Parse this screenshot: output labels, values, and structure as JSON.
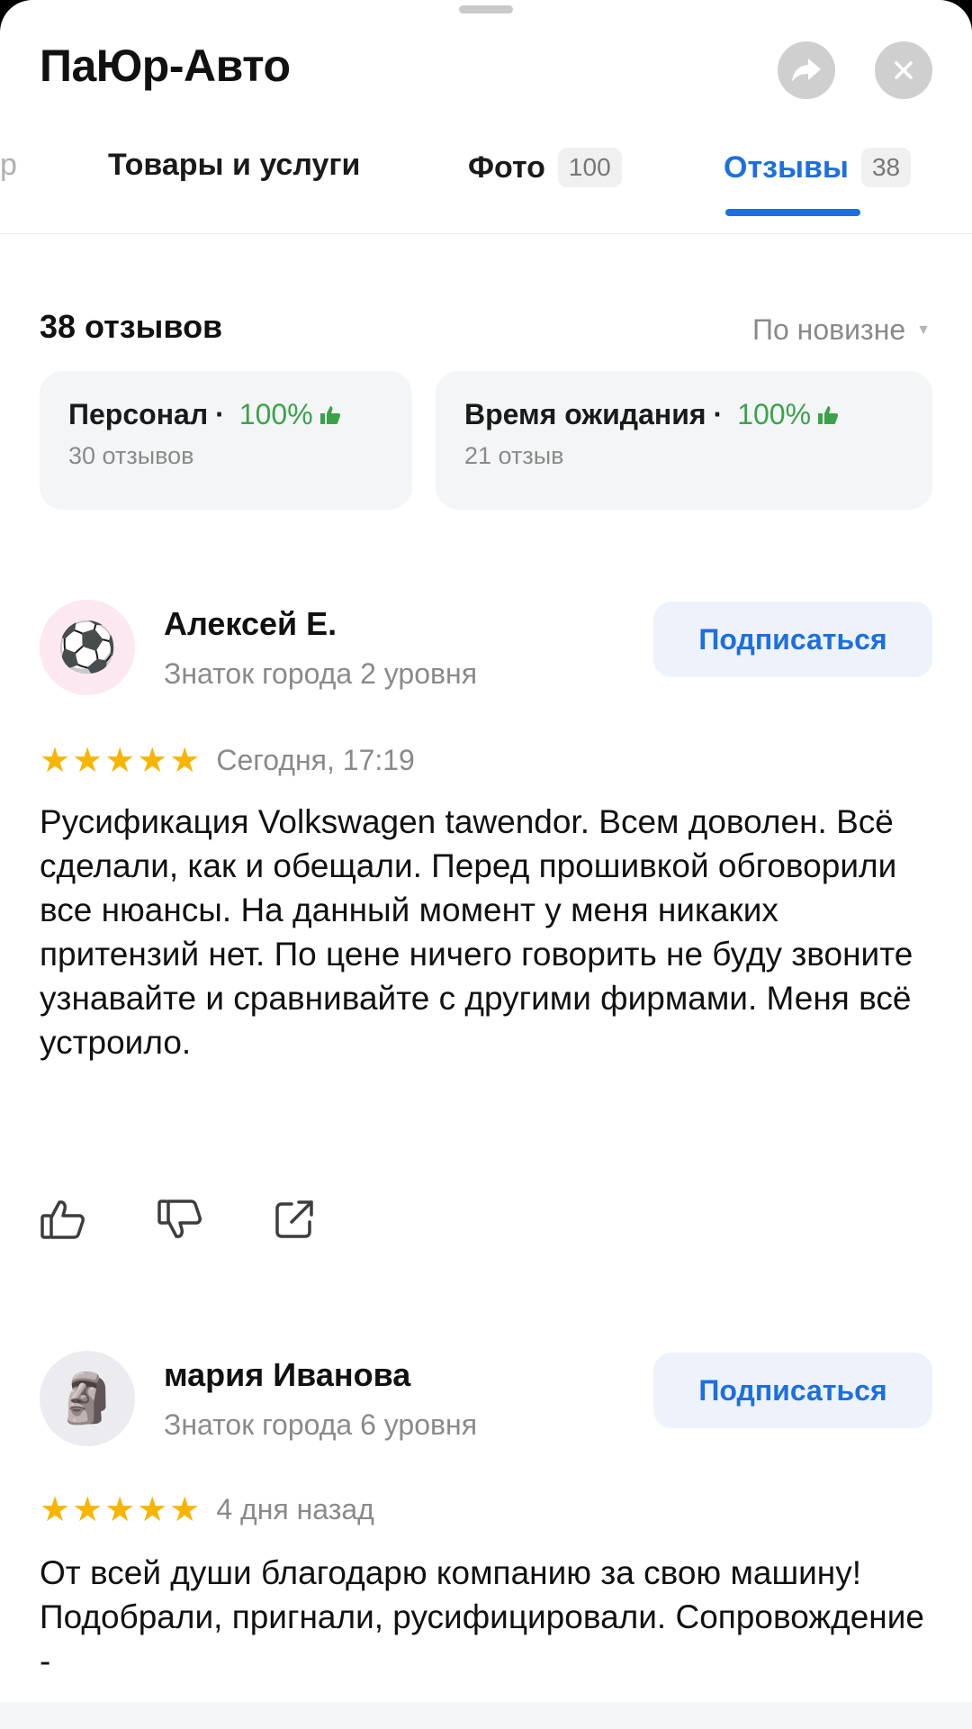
{
  "header": {
    "title": "ПаЮр-Авто",
    "share_icon": "share-arrow-icon",
    "close_icon": "close-icon"
  },
  "tabs": [
    {
      "label": "р",
      "cut": true
    },
    {
      "label": "Товары и услуги"
    },
    {
      "label": "Фото",
      "count": "100"
    },
    {
      "label": "Отзывы",
      "count": "38",
      "active": true
    }
  ],
  "summary": {
    "count_label": "38 отзывов",
    "sort_label": "По новизне"
  },
  "aspects": [
    {
      "name": "Персонал",
      "percent": "100%",
      "sub": "30 отзывов"
    },
    {
      "name": "Время ожидания",
      "percent": "100%",
      "sub": "21 отзыв"
    }
  ],
  "reviews": [
    {
      "author": "Алексей Е.",
      "level": "Знаток города 2 уровня",
      "avatar": "⚽",
      "subscribe_label": "Подписаться",
      "stars": 5,
      "date": "Сегодня, 17:19",
      "text": "Русификация Volkswagen tawendor. Всем доволен. Всё сделали, как и обещали. Перед прошивкой обговорили все нюансы. На данный момент у меня никаких притензий нет. По цене ничего говорить не буду звоните узнавайте и сравнивайте с другими фирмами. Меня всё устроило."
    },
    {
      "author": "мария Иванова",
      "level": "Знаток города 6 уровня",
      "avatar": "🗿",
      "subscribe_label": "Подписаться",
      "stars": 5,
      "date": "4 дня назад",
      "text": "От всей души благодарю компанию за свою машину! Подобрали, пригнали, русифицировали. Сопровождение -"
    }
  ],
  "colors": {
    "accent": "#1d6fe0",
    "star": "#f7b500",
    "positive": "#3aa34a"
  }
}
